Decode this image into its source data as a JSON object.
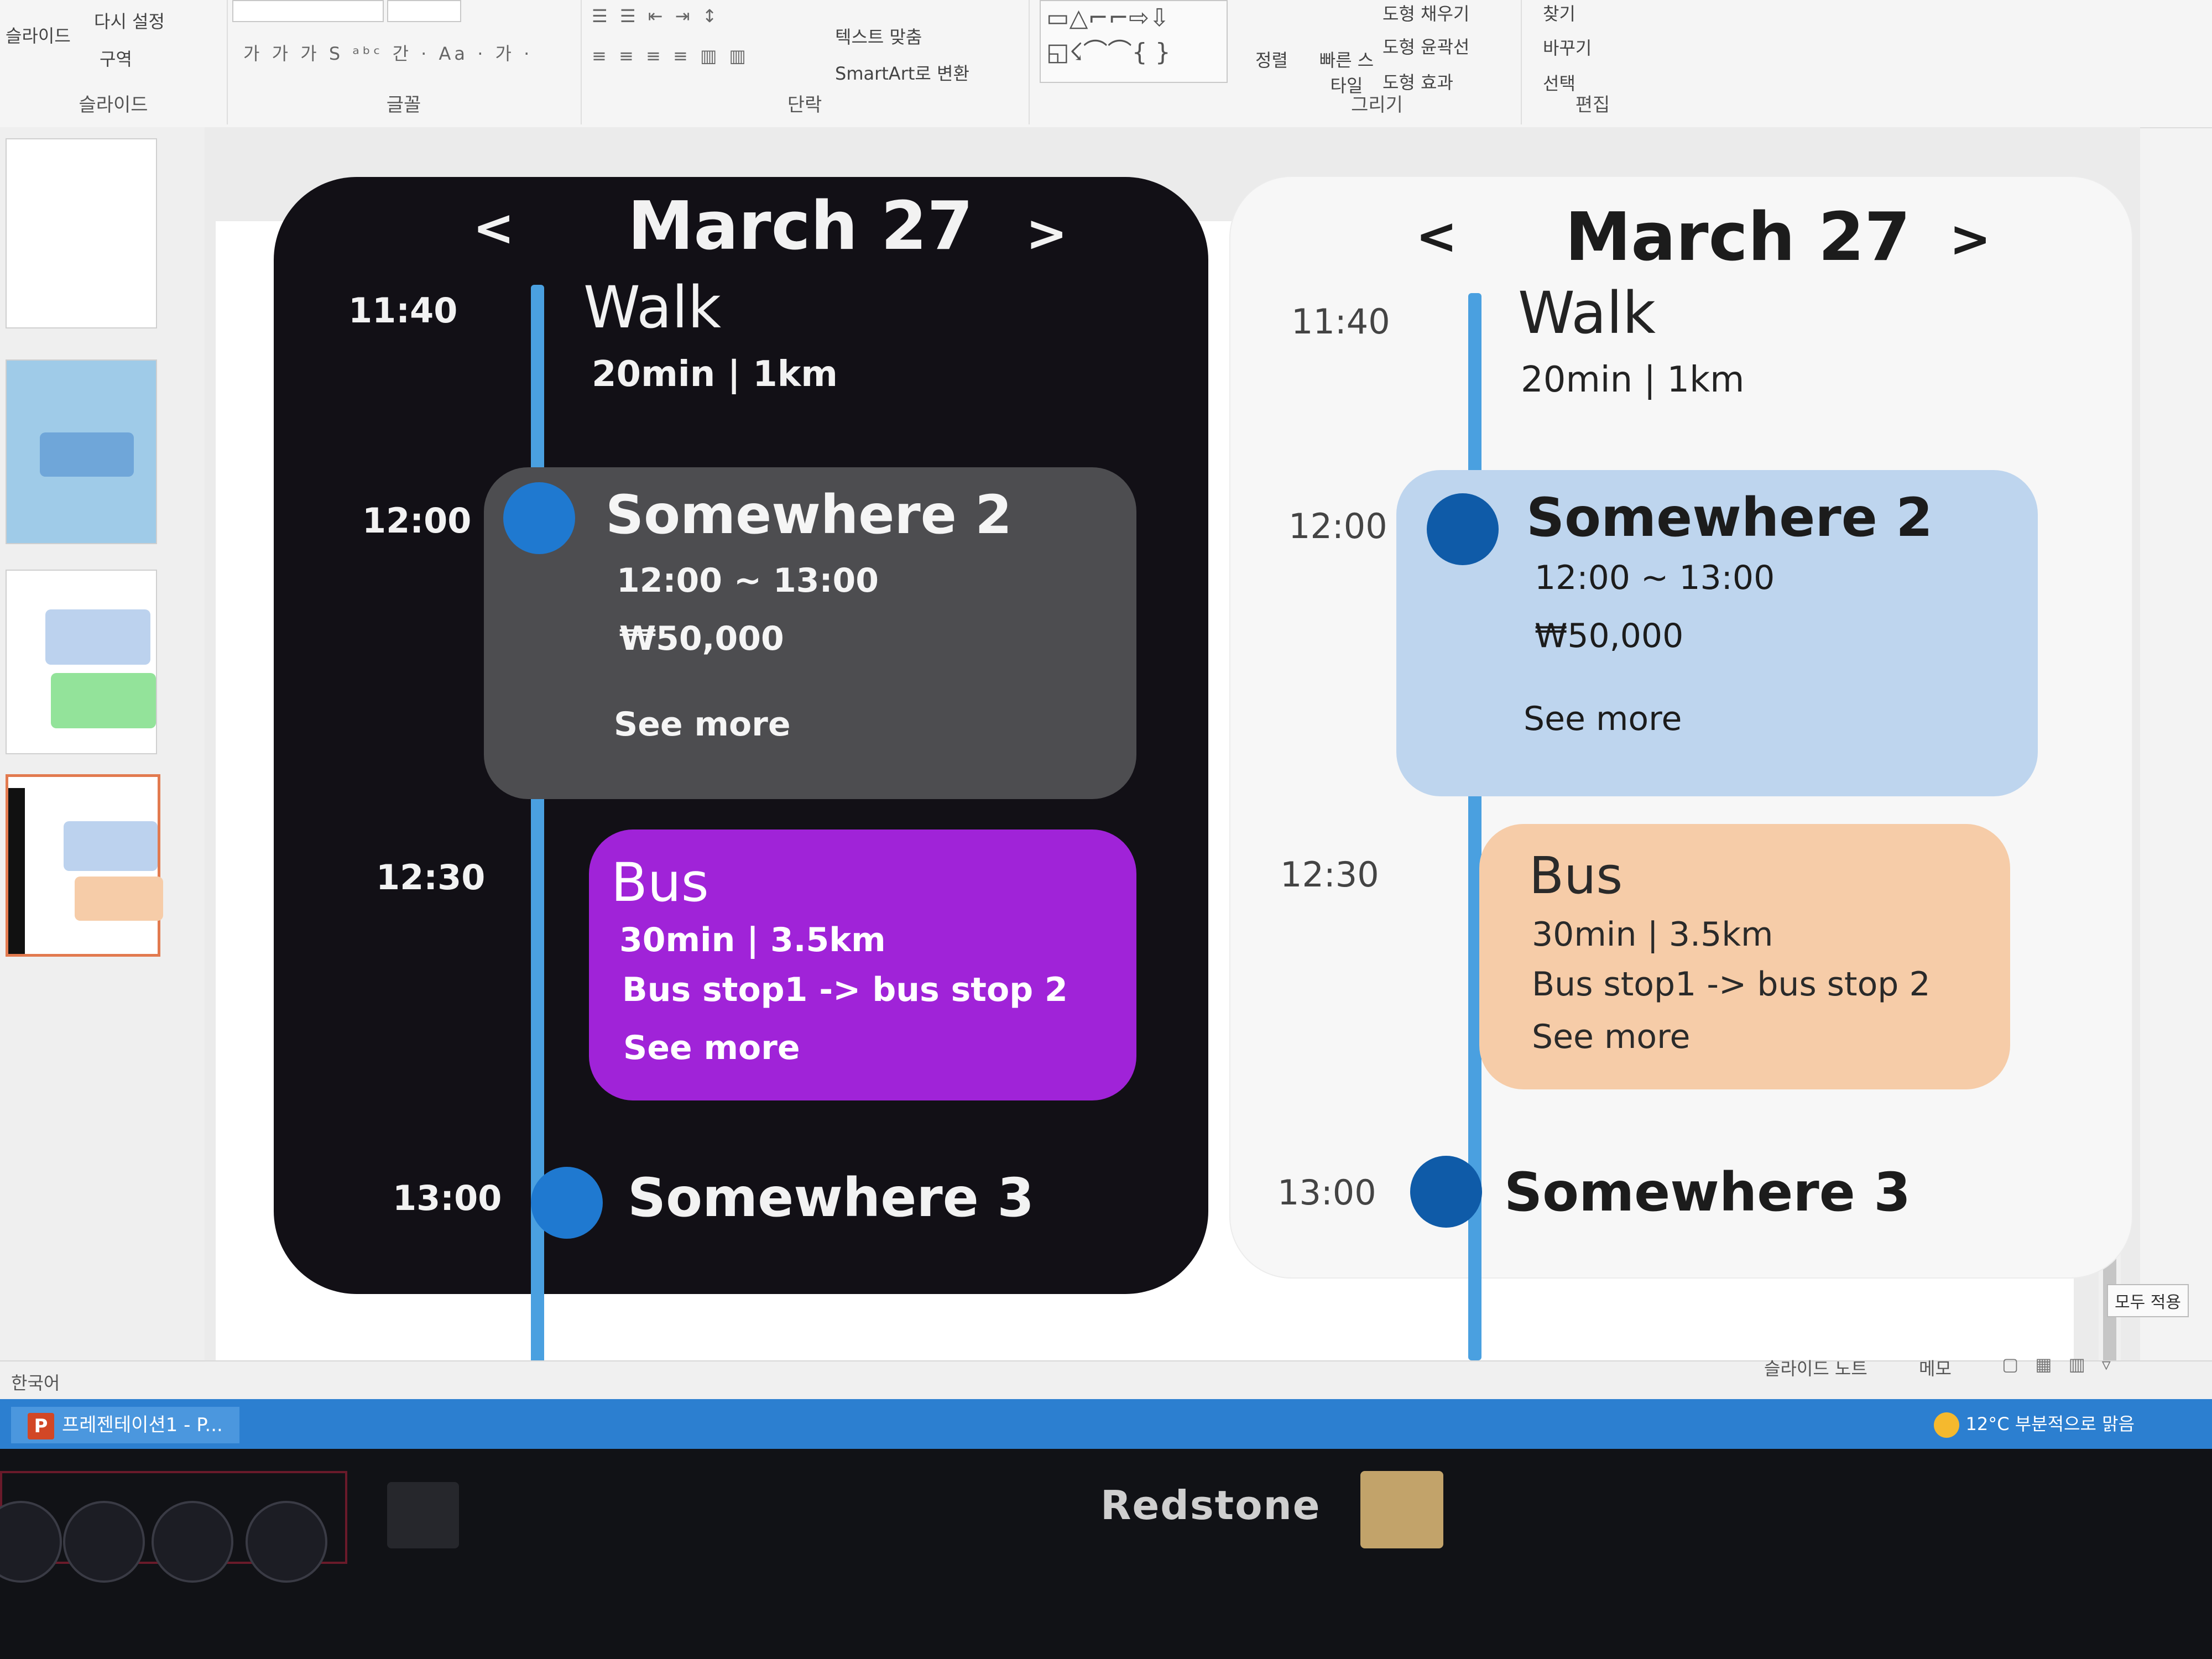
{
  "ribbon": {
    "slides_group": {
      "label": "슬라이드",
      "reset": "다시 설정",
      "section": "구역",
      "new_slide": "슬라이드"
    },
    "font_group": {
      "label": "글꼴"
    },
    "paragraph_group": {
      "label": "단락",
      "text_align": "텍스트 맞춤",
      "smartart": "SmartArt로 변환"
    },
    "drawing_group": {
      "label": "그리기",
      "arrange": "정렬",
      "quick_styles": "빠른 스타일",
      "shape_fill": "도형 채우기",
      "shape_outline": "도형 윤곽선",
      "shape_effects": "도형 효과"
    },
    "editing_group": {
      "label": "편집",
      "find": "찾기",
      "replace": "바꾸기",
      "select": "선택"
    }
  },
  "status": {
    "language": "한국어",
    "notes": "슬라이드 노트",
    "comments": "메모",
    "apply_all": "모두 적용"
  },
  "taskbar": {
    "app": "프레젠테이션1 - P...",
    "weather": "12°C 부분적으로 맑음"
  },
  "monitor": {
    "brand": "Redstone"
  },
  "colors": {
    "accent_line": "#4aa0e0",
    "dark_dot": "#1f79d0",
    "dark_bus": "#a023d8",
    "light_place": "#bed5ee",
    "light_bus": "#f6cca8",
    "light_dot": "#0f5ba8"
  },
  "timeline_dark": {
    "prev": "<",
    "date": "March 27",
    "next": ">",
    "t1": "11:40",
    "walk_title": "Walk",
    "walk_sub": "20min | 1km",
    "t2": "12:00",
    "place_title": "Somewhere 2",
    "place_time": "12:00 ~ 13:00",
    "place_price": "₩50,000",
    "place_more": "See more",
    "t3": "12:30",
    "bus_title": "Bus",
    "bus_sub": "30min | 3.5km",
    "bus_route": "Bus stop1 -> bus stop 2",
    "bus_more": "See more",
    "t4": "13:00",
    "end_title": "Somewhere 3"
  },
  "timeline_light": {
    "prev": "<",
    "date": "March 27",
    "next": ">",
    "t1": "11:40",
    "walk_title": "Walk",
    "walk_sub": "20min | 1km",
    "t2": "12:00",
    "place_title": "Somewhere 2",
    "place_time": "12:00 ~ 13:00",
    "place_price": "₩50,000",
    "place_more": "See more",
    "t3": "12:30",
    "bus_title": "Bus",
    "bus_sub": "30min | 3.5km",
    "bus_route": "Bus stop1 -> bus stop 2",
    "bus_more": "See more",
    "t4": "13:00",
    "end_title": "Somewhere 3"
  }
}
